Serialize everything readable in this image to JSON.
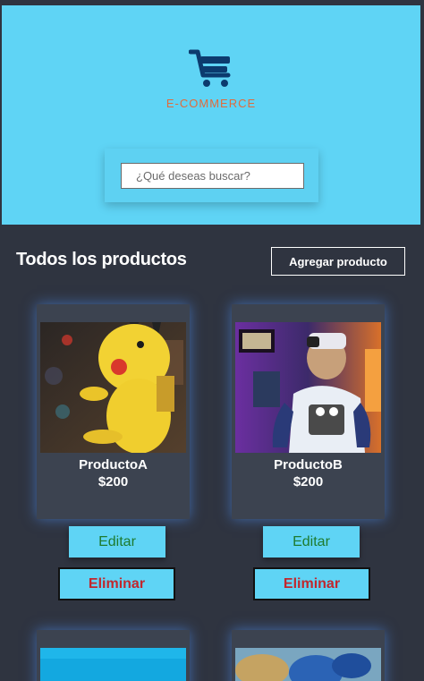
{
  "header": {
    "logo_text": "E-COMMERCE",
    "search": {
      "placeholder": "¿Qué deseas buscar?",
      "value": ""
    }
  },
  "products_section": {
    "title": "Todos los productos",
    "add_button": "Agregar producto"
  },
  "products": [
    {
      "name": "ProductoA",
      "price": "$200",
      "edit_label": "Editar",
      "delete_label": "Eliminar"
    },
    {
      "name": "ProductoB",
      "price": "$200",
      "edit_label": "Editar",
      "delete_label": "Eliminar"
    }
  ],
  "colors": {
    "background": "#2f3440",
    "header": "#5fd4f5",
    "brand_orange": "#e06b3c",
    "cart_blue": "#0c3b6e",
    "edit_text": "#1e7b2f",
    "delete_text": "#c1272d"
  },
  "icons": {
    "logo": "shopping-cart-icon"
  }
}
